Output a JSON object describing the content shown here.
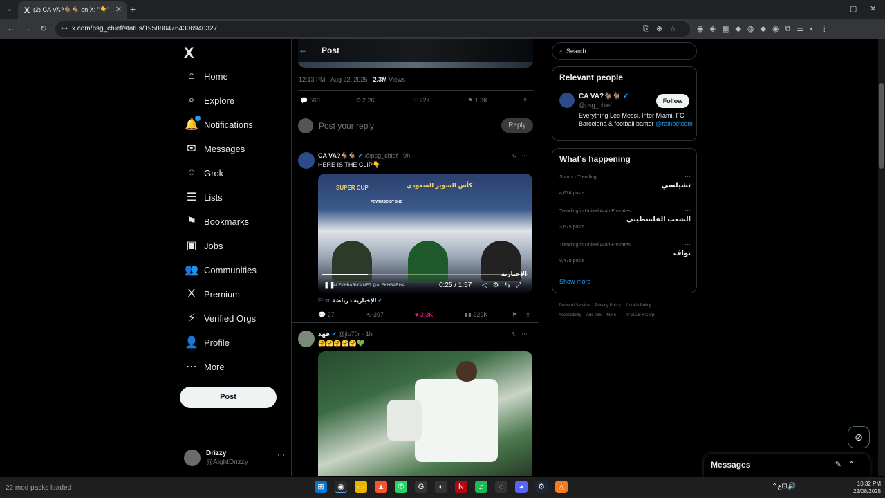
{
  "browser": {
    "tab_title": "(2) CA VA?🐐🐐 on X: \"👇\"",
    "tab_favicon": "X",
    "url": "x.com/psg_chief/status/1958804764306940327",
    "new_tab": "+",
    "win_min": "─",
    "win_max": "▢",
    "win_close": "✕"
  },
  "nav": {
    "logo": "X",
    "items": [
      {
        "label": "Home",
        "icon": "⌂"
      },
      {
        "label": "Explore",
        "icon": "⌕"
      },
      {
        "label": "Notifications",
        "icon": "🔔"
      },
      {
        "label": "Messages",
        "icon": "✉"
      },
      {
        "label": "Grok",
        "icon": "◌"
      },
      {
        "label": "Lists",
        "icon": "☰"
      },
      {
        "label": "Bookmarks",
        "icon": "⚑"
      },
      {
        "label": "Jobs",
        "icon": "▣"
      },
      {
        "label": "Communities",
        "icon": "👥"
      },
      {
        "label": "Premium",
        "icon": "X"
      },
      {
        "label": "Verified Orgs",
        "icon": "⚡"
      },
      {
        "label": "Profile",
        "icon": "👤"
      },
      {
        "label": "More",
        "icon": "⋯"
      }
    ],
    "post_button": "Post",
    "account": {
      "name": "Drizzy",
      "handle": "@AightDrizzy",
      "more": "···"
    }
  },
  "main": {
    "header_title": "Post",
    "meta": {
      "time": "12:13 PM · Aug 22, 2025 · ",
      "views_count": "2.3M",
      "views_label": " Views"
    },
    "stats": {
      "replies": "560",
      "reposts": "2.2K",
      "likes": "22K",
      "bookmarks": "1.3K"
    },
    "reply": {
      "placeholder": "Post your reply",
      "button": "Reply"
    },
    "tweets": [
      {
        "name": "CA VA?🐐🐐",
        "handle": "@psg_chief · 9h",
        "text": "HERE IS THE CLIP👇",
        "video": {
          "banner_left": "SUPER CUP",
          "banner_right": "كأس السوبر السعودي",
          "powered": "POWERED BY SNB",
          "watermark": "ALEKHBARIYA.NET   @ALEKHBARIYA",
          "time": "0:25 / 1:57",
          "corner": "الإخبارية",
          "progress": 0.22
        },
        "from_label": "From ",
        "from_source": "الإخبارية - رياضة",
        "stats": {
          "replies": "27",
          "reposts": "397",
          "likes": "3.3K",
          "views": "229K"
        }
      },
      {
        "name": "فهد",
        "handle": "@jlo70r · 1h",
        "text": "🤗🤗🤗🤗🤗💚"
      }
    ]
  },
  "right": {
    "search_placeholder": "Search",
    "relevant": {
      "title": "Relevant people",
      "name": "CA VA?🐐🐐",
      "handle": "@psg_chief",
      "follow": "Follow",
      "bio": "Everything Leo Messi, Inter Miami, FC Barcelona & football banter ",
      "bio_link": "@rainbetcom"
    },
    "happening": {
      "title": "What’s happening",
      "trends": [
        {
          "category": "Sports · Trending",
          "name": "تشيلسي",
          "count": "4,674 posts"
        },
        {
          "category": "Trending in United Arab Emirates",
          "name": "الشعب الفلسطيني",
          "count": "3,675 posts"
        },
        {
          "category": "Trending in United Arab Emirates",
          "name": "نواف",
          "count": "8,478 posts"
        }
      ],
      "show_more": "Show more"
    },
    "footer": [
      "Terms of Service",
      "Privacy Policy",
      "Cookie Policy",
      "Accessibility",
      "Ads info",
      "More ···",
      "© 2025 X Corp."
    ]
  },
  "messages_drawer": {
    "title": "Messages"
  },
  "taskbar": {
    "status": "22 mod packs loaded",
    "time": "10:32 PM",
    "date": "22/08/2025",
    "lang": "ع"
  }
}
